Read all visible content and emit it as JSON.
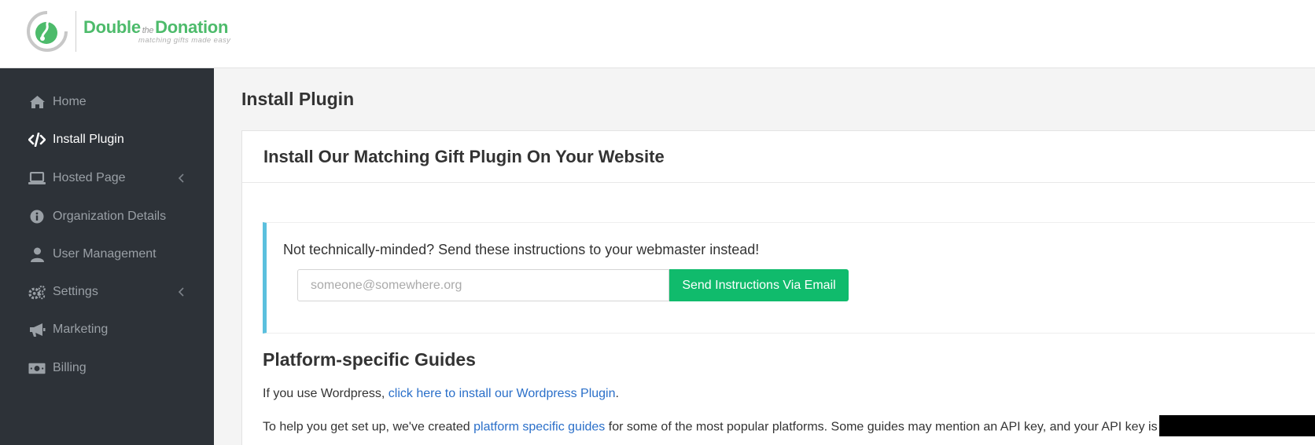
{
  "brand": {
    "title_before": "Double",
    "title_the": "the",
    "title_after": "Donation",
    "tagline": "matching gifts made easy",
    "colors": {
      "green": "#4dbb6b",
      "sidebar": "#2d3238",
      "button": "#10bb6c",
      "link": "#2a6fc9",
      "callout_border": "#5bc0de"
    }
  },
  "sidebar": {
    "items": [
      {
        "label": "Home",
        "icon": "home-icon",
        "active": false,
        "has_chevron": false
      },
      {
        "label": "Install Plugin",
        "icon": "code-icon",
        "active": true,
        "has_chevron": false
      },
      {
        "label": "Hosted Page",
        "icon": "laptop-icon",
        "active": false,
        "has_chevron": true
      },
      {
        "label": "Organization Details",
        "icon": "info-icon",
        "active": false,
        "has_chevron": false
      },
      {
        "label": "User Management",
        "icon": "user-icon",
        "active": false,
        "has_chevron": false
      },
      {
        "label": "Settings",
        "icon": "gears-icon",
        "active": false,
        "has_chevron": true
      },
      {
        "label": "Marketing",
        "icon": "bullhorn-icon",
        "active": false,
        "has_chevron": false
      },
      {
        "label": "Billing",
        "icon": "money-icon",
        "active": false,
        "has_chevron": false
      }
    ]
  },
  "main": {
    "page_title": "Install Plugin",
    "card_title": "Install Our Matching Gift Plugin On Your Website",
    "callout": {
      "text": "Not technically-minded? Send these instructions to your webmaster instead!",
      "email_placeholder": "someone@somewhere.org",
      "email_value": "",
      "send_button": "Send Instructions Via Email"
    },
    "guides": {
      "title": "Platform-specific Guides",
      "para1_prefix": "If you use Wordpress, ",
      "para1_link": "click here to install our Wordpress Plugin",
      "para1_suffix": ".",
      "para2_prefix": "To help you get set up, we've created ",
      "para2_link": "platform specific guides",
      "para2_suffix": " for some of the most popular platforms. Some guides may mention an API key, and your API key is"
    }
  }
}
